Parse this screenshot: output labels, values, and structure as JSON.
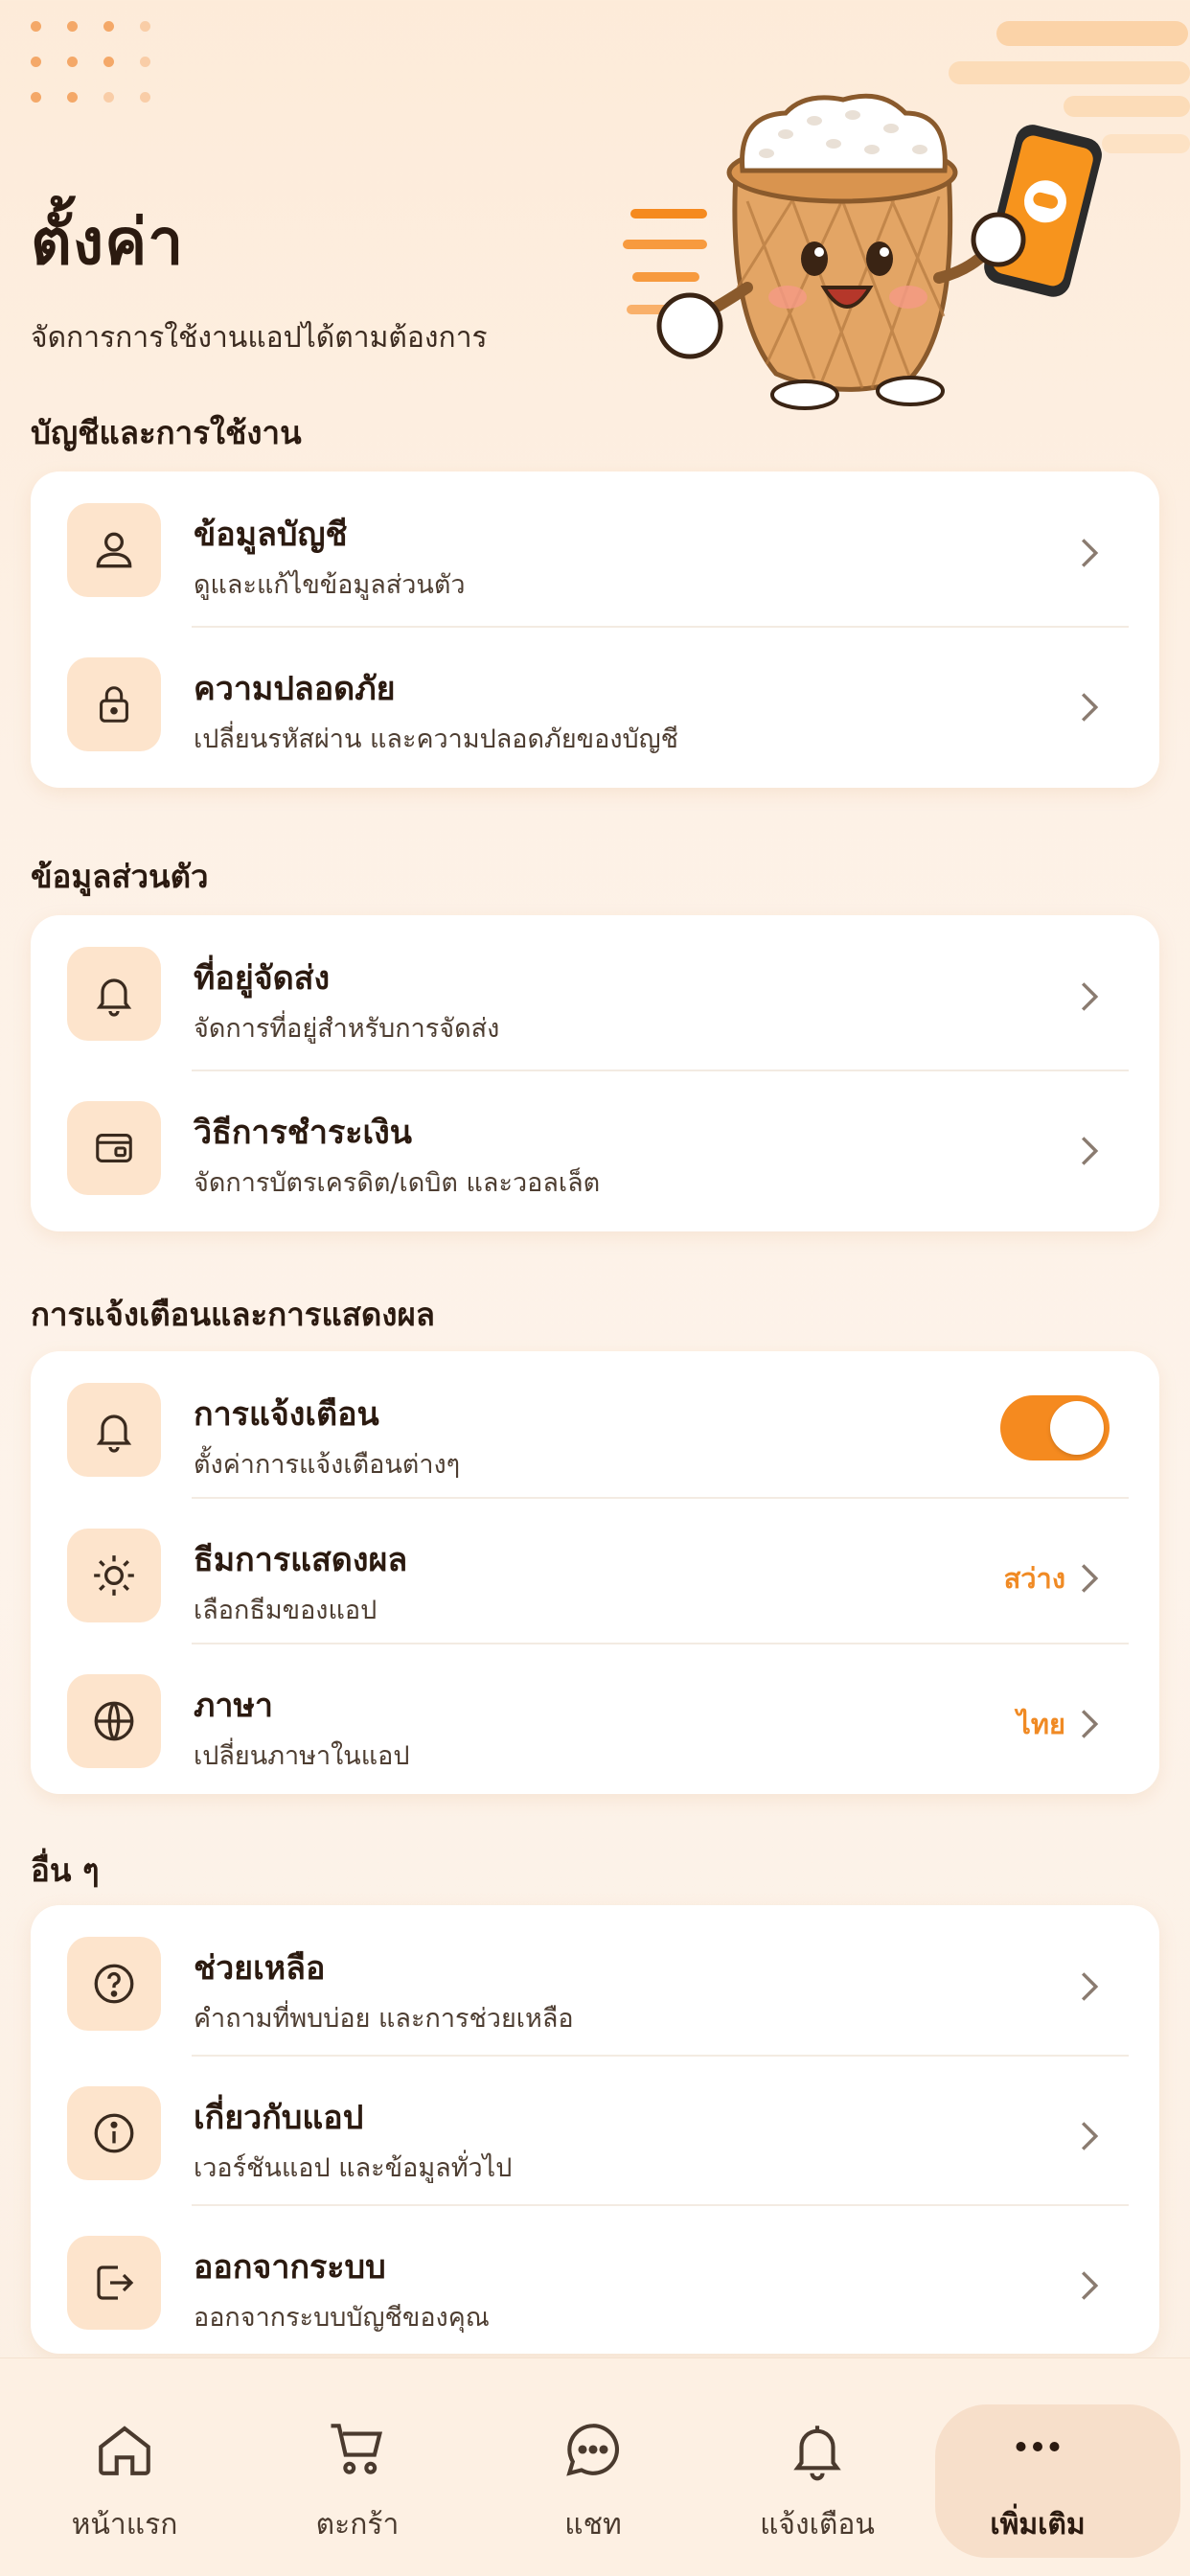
{
  "header": {
    "title": "ตั้งค่า",
    "subtitle": "จัดการการใช้งานแอปได้ตามต้องการ"
  },
  "sections": [
    {
      "title": "บัญชีและการใช้งาน",
      "items": [
        {
          "title": "ข้อมูลบัญชี",
          "desc": "ดูและแก้ไขข้อมูลส่วนตัว",
          "icon": "user-icon"
        },
        {
          "title": "ความปลอดภัย",
          "desc": "เปลี่ยนรหัสผ่าน และความปลอดภัยของบัญชี",
          "icon": "lock-icon"
        }
      ]
    },
    {
      "title": "ข้อมูลส่วนตัว",
      "items": [
        {
          "title": "ที่อยู่จัดส่ง",
          "desc": "จัดการที่อยู่สำหรับการจัดส่ง",
          "icon": "bell-icon"
        },
        {
          "title": "วิธีการชำระเงิน",
          "desc": "จัดการบัตรเครดิต/เดบิต และวอลเล็ต",
          "icon": "wallet-icon"
        }
      ]
    },
    {
      "title": "การแจ้งเตือนและการแสดงผล",
      "items": [
        {
          "title": "การแจ้งเตือน",
          "desc": "ตั้งค่าการแจ้งเตือนต่างๆ",
          "icon": "bell-icon",
          "toggle_on": true
        },
        {
          "title": "ธีมการแสดงผล",
          "desc": "เลือกธีมของแอป",
          "icon": "sun-icon",
          "value": "สว่าง"
        },
        {
          "title": "ภาษา",
          "desc": "เปลี่ยนภาษาในแอป",
          "icon": "globe-icon",
          "value": "ไทย"
        }
      ]
    },
    {
      "title": "อื่น ๆ",
      "items": [
        {
          "title": "ช่วยเหลือ",
          "desc": "คำถามที่พบบ่อย และการช่วยเหลือ",
          "icon": "help-icon"
        },
        {
          "title": "เกี่ยวกับแอป",
          "desc": "เวอร์ชันแอป และข้อมูลทั่วไป",
          "icon": "info-icon"
        },
        {
          "title": "ออกจากระบบ",
          "desc": "ออกจากระบบบัญชีของคุณ",
          "icon": "logout-icon"
        }
      ]
    }
  ],
  "tabbar": [
    {
      "label": "หน้าแรก",
      "icon": "home-icon"
    },
    {
      "label": "ตะกร้า",
      "icon": "cart-icon"
    },
    {
      "label": "แชท",
      "icon": "chat-icon"
    },
    {
      "label": "แจ้งเตือน",
      "icon": "bell-icon"
    },
    {
      "label": "เพิ่มเติม",
      "icon": "more-icon",
      "active": true
    }
  ],
  "colors": {
    "accent": "#f58a1f",
    "icon_bg": "#fde4cc",
    "background": "#fdefe2",
    "text": "#2b1a10"
  }
}
